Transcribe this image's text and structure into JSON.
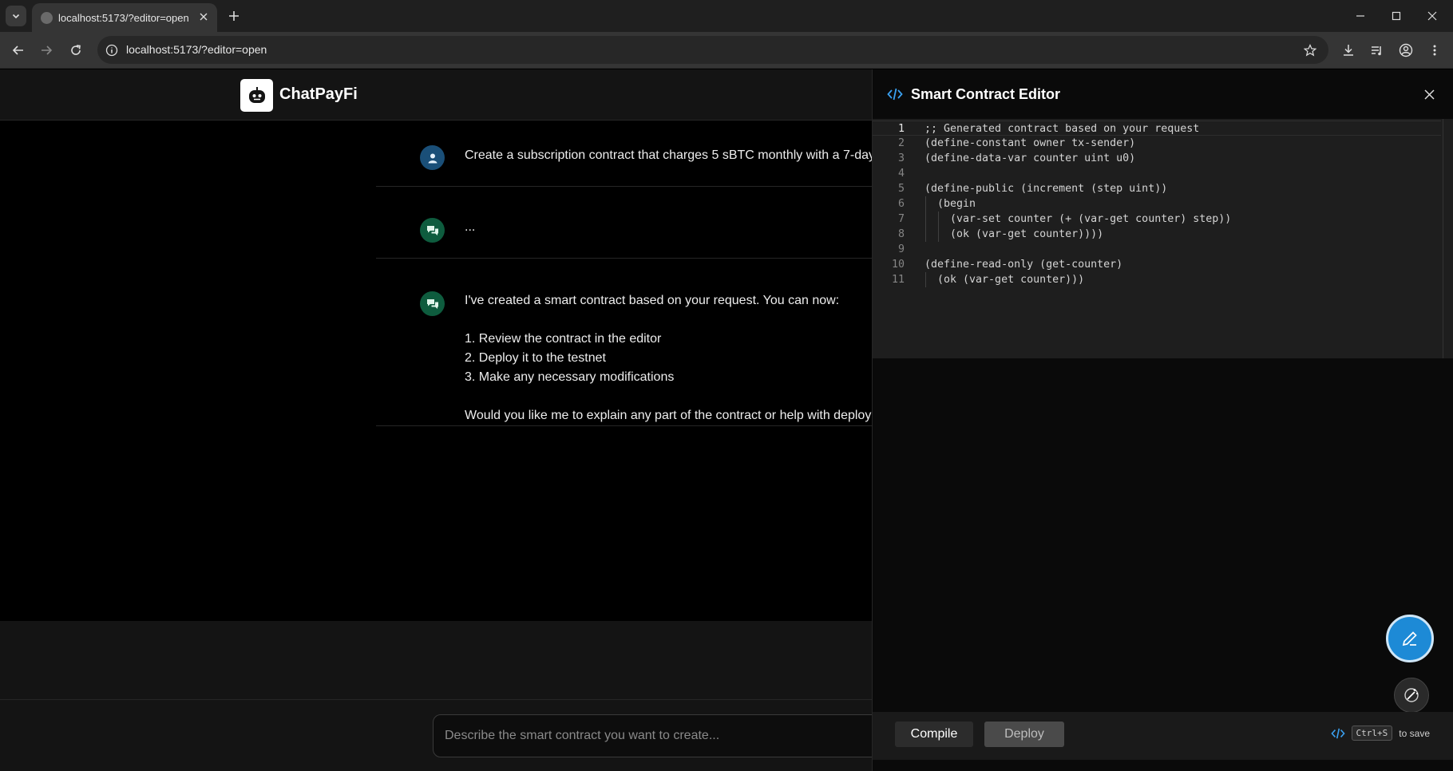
{
  "browser": {
    "tab_title": "localhost:5173/?editor=open",
    "url": "localhost:5173/?editor=open"
  },
  "app": {
    "brand": "ChatPayFi"
  },
  "chat": {
    "messages": [
      {
        "role": "user",
        "lines": [
          "Create a subscription contract that charges 5 sBTC monthly with a 7-day"
        ]
      },
      {
        "role": "assistant",
        "lines": [
          "..."
        ]
      },
      {
        "role": "assistant",
        "lines": [
          "I've created a smart contract based on your request. You can now:",
          "",
          "1. Review the contract in the editor",
          "2. Deploy it to the testnet",
          "3. Make any necessary modifications",
          "",
          "Would you like me to explain any part of the contract or help with deploy"
        ]
      }
    ],
    "composer_placeholder": "Describe the smart contract you want to create..."
  },
  "editor": {
    "title": "Smart Contract Editor",
    "active_line": 1,
    "code_lines": [
      ";; Generated contract based on your request",
      "(define-constant owner tx-sender)",
      "(define-data-var counter uint u0)",
      "",
      "(define-public (increment (step uint))",
      "  (begin",
      "    (var-set counter (+ (var-get counter) step))",
      "    (ok (var-get counter))))",
      "",
      "(define-read-only (get-counter)",
      "  (ok (var-get counter)))"
    ],
    "compile_label": "Compile",
    "deploy_label": "Deploy",
    "save_shortcut": "Ctrl+S",
    "save_hint": "to save"
  },
  "colors": {
    "accent": "#1d8ad6",
    "user_avatar": "#1a4f78",
    "bot_avatar": "#0e5c3e"
  }
}
